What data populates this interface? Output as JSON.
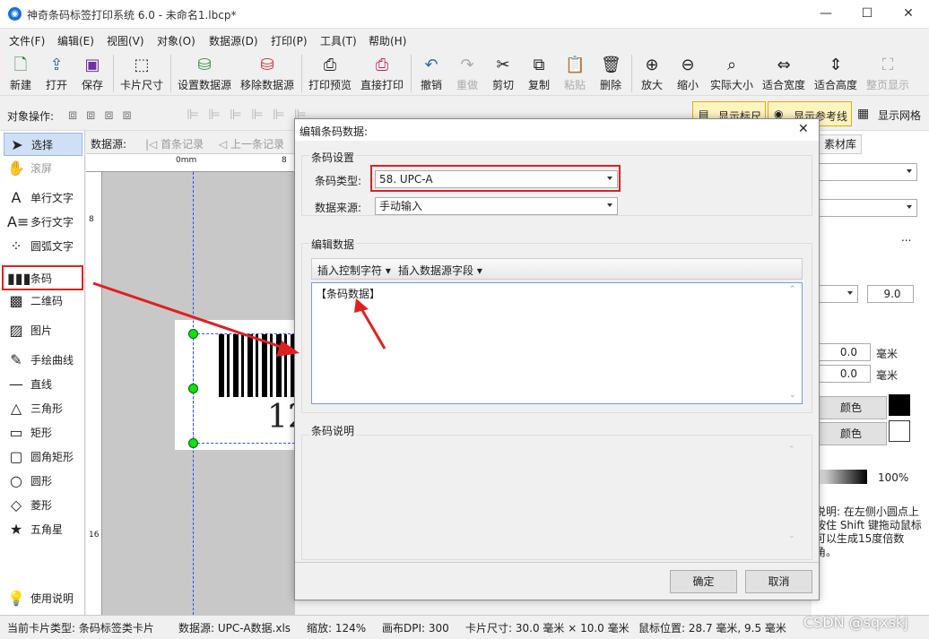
{
  "window": {
    "title": "神奇条码标签打印系统 6.0 - 未命名1.lbcp*",
    "min": "—",
    "max": "☐",
    "close": "✕"
  },
  "menu": [
    "文件(F)",
    "编辑(E)",
    "视图(V)",
    "对象(O)",
    "数据源(D)",
    "打印(P)",
    "工具(T)",
    "帮助(H)"
  ],
  "toolbar": [
    {
      "label": "新建",
      "icon": "new-file-icon"
    },
    {
      "label": "打开",
      "icon": "open-icon"
    },
    {
      "label": "保存",
      "icon": "save-icon"
    },
    {
      "label": "卡片尺寸",
      "icon": "card-size-icon"
    },
    {
      "label": "设置数据源",
      "icon": "set-datasource-icon"
    },
    {
      "label": "移除数据源",
      "icon": "remove-datasource-icon"
    },
    {
      "label": "打印预览",
      "icon": "print-preview-icon"
    },
    {
      "label": "直接打印",
      "icon": "print-icon"
    },
    {
      "label": "撤销",
      "icon": "undo-icon"
    },
    {
      "label": "重做",
      "icon": "redo-icon"
    },
    {
      "label": "剪切",
      "icon": "cut-icon"
    },
    {
      "label": "复制",
      "icon": "copy-icon"
    },
    {
      "label": "粘贴",
      "icon": "paste-icon"
    },
    {
      "label": "删除",
      "icon": "delete-icon"
    },
    {
      "label": "放大",
      "icon": "zoom-in-icon"
    },
    {
      "label": "缩小",
      "icon": "zoom-out-icon"
    },
    {
      "label": "实际大小",
      "icon": "actual-size-icon"
    },
    {
      "label": "适合宽度",
      "icon": "fit-width-icon"
    },
    {
      "label": "适合高度",
      "icon": "fit-height-icon"
    },
    {
      "label": "整页显示",
      "icon": "full-page-icon"
    }
  ],
  "ops": {
    "label": "对象操作:",
    "show_ruler": "显示标尺",
    "show_guides": "显示参考线",
    "show_grid": "显示网格"
  },
  "datasource_bar": {
    "label": "数据源:",
    "first": "首条记录",
    "prev": "上一条记录"
  },
  "tools": [
    {
      "label": "选择",
      "icon": "pointer-icon"
    },
    {
      "label": "滚屏",
      "icon": "hand-icon"
    },
    {
      "label": "单行文字",
      "icon": "single-text-icon"
    },
    {
      "label": "多行文字",
      "icon": "multi-text-icon"
    },
    {
      "label": "圆弧文字",
      "icon": "arc-text-icon"
    },
    {
      "label": "条码",
      "icon": "barcode-icon"
    },
    {
      "label": "二维码",
      "icon": "qrcode-icon"
    },
    {
      "label": "图片",
      "icon": "image-icon"
    },
    {
      "label": "手绘曲线",
      "icon": "pen-icon"
    },
    {
      "label": "直线",
      "icon": "line-icon"
    },
    {
      "label": "三角形",
      "icon": "triangle-icon"
    },
    {
      "label": "矩形",
      "icon": "rectangle-icon"
    },
    {
      "label": "圆角矩形",
      "icon": "rounded-rect-icon"
    },
    {
      "label": "圆形",
      "icon": "circle-icon"
    },
    {
      "label": "菱形",
      "icon": "diamond-icon"
    },
    {
      "label": "五角星",
      "icon": "star-icon"
    },
    {
      "label": "使用说明",
      "icon": "bulb-icon"
    }
  ],
  "canvas": {
    "ruler_zero": "0mm",
    "ruler_8": "8",
    "ruler_v8": "8",
    "ruler_v16": "16",
    "barcode_digits": "12"
  },
  "right": {
    "tab": "素材库",
    "val_9": "9.0",
    "val_00a": "0.0",
    "val_00b": "0.0",
    "unit_a": "毫米",
    "unit_b": "毫米",
    "color1": "颜色",
    "color2": "颜色",
    "pct": "100%",
    "help": "说明: 在左侧小圆点上按住 Shift 键拖动鼠标可以生成15度倍数角。",
    "ellipsis": "..."
  },
  "dialog": {
    "title": "编辑条码数据:",
    "group1": "条码设置",
    "type_label": "条码类型:",
    "type_value": "58. UPC-A",
    "source_label": "数据来源:",
    "source_value": "手动输入",
    "group2": "编辑数据",
    "insert_ctrl": "插入控制字符",
    "insert_field": "插入数据源字段",
    "content": "【条码数据】",
    "group3": "条码说明",
    "ok": "确定",
    "cancel": "取消"
  },
  "status": {
    "card_type": "当前卡片类型: 条码标签类卡片",
    "datasource": "数据源: UPC-A数据.xls",
    "zoom": "缩放: 124%",
    "dpi": "画布DPI: 300",
    "card_size": "卡片尺寸: 30.0 毫米 × 10.0 毫米",
    "mouse": "鼠标位置: 28.7 毫米, 9.5 毫米",
    "watermark": "CSDN @sqxskj"
  }
}
